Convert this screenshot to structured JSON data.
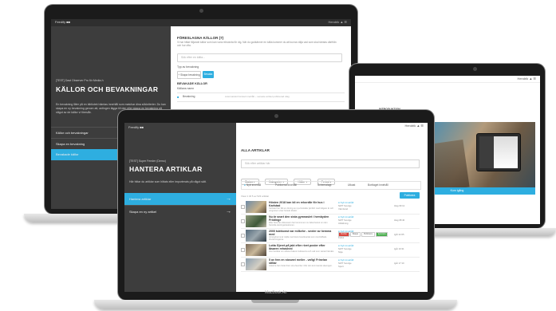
{
  "laptop_left": {
    "app_brand": "Feedify ■■",
    "topbar_right": "Hendrik  ▲  ☰",
    "sidebar": {
      "eyebrow": "[TEST] Dast Observer Pro för Media‑h",
      "title": "KÄLLOR OCH BEVAKNINGAR",
      "description": "En bevakning låter på en bibliotek hämtas innehåll som matchar dina sökkriterier. Du kan skapa en ny bevakning genom att, antingen lägga till den eller skapa en bevakning på något av de källor vi föreslår.",
      "nav": [
        "Källor och bevakningar",
        "Skapa en bevakning",
        "Bevakade källor"
      ],
      "active_index": 2
    },
    "main": {
      "section_title": "FÖRESLAGNA KÄLLOR (7)",
      "section_desc": "Vi har hittat följande källor som kan vara relevanta för dig. När du godkänner en källa kommer du att kunna välja vad som ska hämtas därifrån och hur ofta.",
      "search_placeholder": "Sök efter en källa...",
      "bevakning_label": "Typ av bevakning",
      "btn_primary": "Bevaka",
      "btn_secondary": "+ Skapa bevakning",
      "subsection": "BEVAKADE KÄLLOR",
      "field_label": "Källans namn",
      "row_name": "Bevakning",
      "row_desc": "Automatiskt hämtat innehåll – senaste artikel publicerad idag"
    }
  },
  "laptop_right": {
    "topbar_right": "Hendrik  ▲  ☰",
    "section_label": "INTRODUKTION",
    "cta": "Kom igång"
  },
  "laptop_front": {
    "app_brand": "Feedify ■■",
    "topbar_right": "Hendrik  ▲  ☰",
    "model": "MacBook Air",
    "sidebar": {
      "eyebrow": "[TEST] Super Feeder (Demo)",
      "title": "HANTERA ARTIKLAR",
      "description": "Här hittar du artiklar som hittats eller importerats på något sätt.",
      "nav": [
        "Hantera artiklar",
        "Skapa en ny artikel"
      ],
      "active_index": 0
    },
    "main": {
      "section_title": "ALLA ARTIKLAR",
      "search_placeholder": "Sök efter artiklar här",
      "filters": [
        "Status ▾",
        "Kategorier ▾",
        "Källor ▾",
        "Period ▾"
      ],
      "tabs": [
        "Nytt innehåll",
        "Publicerat innehåll",
        "Schemalagt",
        "Utkast",
        "Borttaget innehåll"
      ],
      "count_label": "Visar 1 till 5 av 523 artiklar",
      "action_button": "Publicera",
      "articles": [
        {
          "title": "Hösten 2018 kan bli en rekordår för hus i Karlstad",
          "excerpt": "Karlstad har fått en ökning av nya bostäder jämfört med tidigare år och prognosen visar fortsatt tillväxt.",
          "status": "Nytt innehåll",
          "source": "NWT Sverige",
          "category": "Värmland",
          "date": "Idag 09:12"
        },
        {
          "title": "Nu är snart den sista gymnasiet i hembyden Frödinge",
          "excerpt": "Efter flera års diskussion har kommunen nu fattat beslut om den framtida skolorganisationen.",
          "status": "Nytt innehåll",
          "source": "NWT Sverige",
          "category": "Utbildning",
          "date": "Idag 08:40"
        },
        {
          "title": "2000 tuktkonst var milkehe - sexter av hemma med",
          "excerpt": "Arrangörerna är nöjda med årets besöksantal som överträffade förväntningarna.",
          "status": "Nytt innehåll",
          "source": "NWT Sverige",
          "category": "Kultur",
          "date": "Igår 22:05"
        },
        {
          "title": "Lotta Gjeret på jakt efter rivet poster efter läsaren rehashed",
          "excerpt": "Hon berättar om arbetet bakom kulisserna och vad som väntar härnäst.",
          "status": "Nytt innehåll",
          "source": "NWT Sverige",
          "category": "Nöje",
          "date": "Igår 19:31"
        },
        {
          "title": "5 av fem en stoswei meiler - vafig! Frinelan stiltar",
          "excerpt": "Läsarna har röstat fram sina favoriter inför den kommande säsongen.",
          "status": "Nytt innehåll",
          "source": "NWT Sverige",
          "category": "Sport",
          "date": "Igår 17:10"
        }
      ],
      "action_tags": [
        "Avvisa",
        "Skapa",
        "Publicera",
        "Ignorera"
      ]
    }
  },
  "colors": {
    "accent": "#2eaee0",
    "sidebar": "#3d3d3d",
    "topbar": "#2f2f2f",
    "laptop_bezel": "#1b1b1b",
    "tag_red": "#d9453d",
    "tag_green": "#4caf50"
  }
}
